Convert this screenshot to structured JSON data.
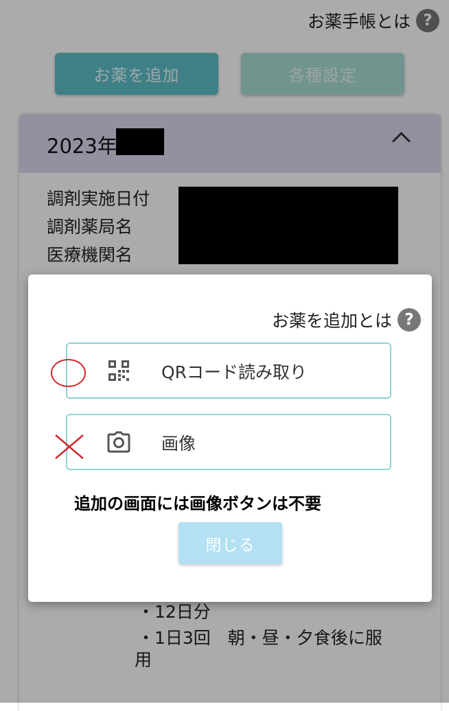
{
  "header": {
    "help_label": "お薬手帳とは",
    "help_icon": "question-circle-icon"
  },
  "toolbar": {
    "add_label": "お薬を追加",
    "settings_label": "各種設定"
  },
  "record": {
    "year": "2023年",
    "fields": [
      "調剤実施日付",
      "調剤薬局名",
      "医療機関名"
    ],
    "details": [
      "・12日分",
      "・1日3回　朝・昼・夕食後に服",
      "用"
    ]
  },
  "modal": {
    "help_label": "お薬を追加とは",
    "help_icon": "question-circle-icon",
    "options": [
      {
        "label": "QRコード読み取り",
        "icon": "qr-code-icon"
      },
      {
        "label": "画像",
        "icon": "camera-icon"
      }
    ],
    "note": "追加の画面には画像ボタンは不要",
    "close_label": "閉じる"
  },
  "colors": {
    "accent": "#5ebfc9",
    "card_header": "#dcd9ef",
    "option_border": "#8fd4d8",
    "close_button": "#b3e0f2",
    "annotation_red": "#d0272b"
  }
}
